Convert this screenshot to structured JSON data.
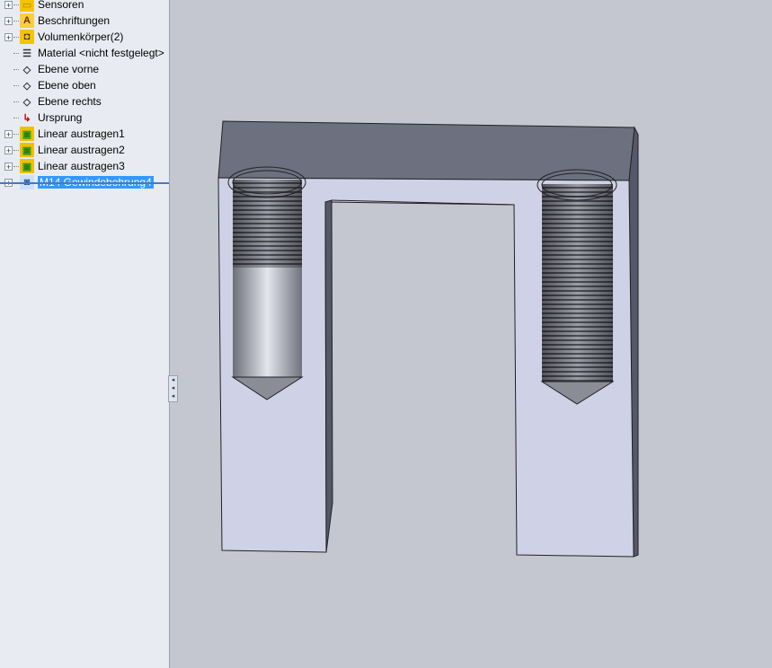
{
  "tree": {
    "items": [
      {
        "label": "Sensoren",
        "icon": "folder-icon",
        "expand": true
      },
      {
        "label": "Beschriftungen",
        "icon": "annotations-icon",
        "expand": true
      },
      {
        "label": "Volumenkörper(2)",
        "icon": "solid-bodies-icon",
        "expand": true
      },
      {
        "label": "Material <nicht festgelegt>",
        "icon": "material-icon",
        "expand": false
      },
      {
        "label": "Ebene vorne",
        "icon": "plane-icon",
        "expand": false
      },
      {
        "label": "Ebene oben",
        "icon": "plane-icon",
        "expand": false
      },
      {
        "label": "Ebene rechts",
        "icon": "plane-icon",
        "expand": false
      },
      {
        "label": "Ursprung",
        "icon": "origin-icon",
        "expand": false
      },
      {
        "label": "Linear austragen1",
        "icon": "extrude-icon",
        "expand": true
      },
      {
        "label": "Linear austragen2",
        "icon": "extrude-icon",
        "expand": true
      },
      {
        "label": "Linear austragen3",
        "icon": "extrude-icon",
        "expand": true
      },
      {
        "label": "M14 Gewindebohrung4",
        "icon": "hole-wizard-icon",
        "expand": true,
        "selected": true
      }
    ]
  },
  "colors": {
    "front": "#cfd2e6",
    "top": "#6d707f",
    "side": "#55586a",
    "bg": "#c4c7d0"
  }
}
